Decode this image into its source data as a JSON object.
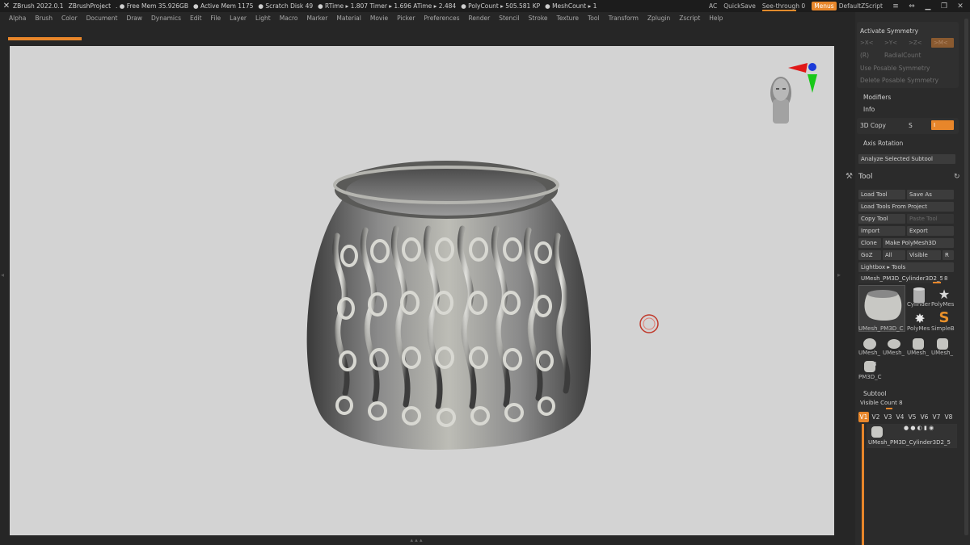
{
  "titlebar": {
    "app": "ZBrush 2022.0.1",
    "project": "ZBrushProject",
    "free_mem": ". ● Free Mem 35.926GB",
    "active_mem": "● Active Mem 1175",
    "scratch": "● Scratch Disk 49",
    "rtime": "● RTime ▸ 1.807 Timer ▸ 1.696 ATime ▸ 2.484",
    "polycount": "● PolyCount ▸ 505.581 KP",
    "meshcount": "● MeshCount ▸ 1",
    "ac": "AC",
    "quicksave": "QuickSave",
    "see_through": "See-through   0",
    "menus": "Menus",
    "zscript": "DefaultZScript"
  },
  "menu": [
    "Alpha",
    "Brush",
    "Color",
    "Document",
    "Draw",
    "Dynamics",
    "Edit",
    "File",
    "Layer",
    "Light",
    "Macro",
    "Marker",
    "Material",
    "Movie",
    "Picker",
    "Preferences",
    "Render",
    "Stencil",
    "Stroke",
    "Texture",
    "Tool",
    "Transform",
    "Zplugin",
    "Zscript",
    "Help"
  ],
  "symmetry": {
    "activate": "Activate Symmetry",
    "x": ">X<",
    "y": ">Y<",
    "z": ">Z<",
    "m": ">M<",
    "r": "(R)",
    "radial": "RadialCount",
    "use_posable": "Use Posable Symmetry",
    "delete_posable": "Delete Posable Symmetry"
  },
  "modifiers": "Modifiers",
  "info": "Info",
  "copy3d": {
    "label": "3D Copy",
    "s": "S",
    "i": "I"
  },
  "axis_rotation": "Axis Rotation",
  "analyze": "Analyze Selected Subtool",
  "tool": {
    "title": "Tool",
    "load_tool": "Load Tool",
    "save_as": "Save As",
    "load_from_project": "Load Tools From Project",
    "copy_tool": "Copy Tool",
    "paste_tool": "Paste Tool",
    "import": "Import",
    "export": "Export",
    "clone": "Clone",
    "make_polymesh": "Make PolyMesh3D",
    "goz": "GoZ",
    "all": "All",
    "visible": "Visible",
    "r": "R",
    "lightbox": "Lightbox ▸ Tools",
    "current": "UMesh_PM3D_Cylinder3D2_5",
    "current_count": "8",
    "thumbs": [
      "UMesh_PM3D_C",
      "Cylinder",
      "PolyMes",
      "PolyMes",
      "SimpleB",
      "UMesh_",
      "UMesh_",
      "UMesh_",
      "UMesh_",
      "PM3D_C"
    ],
    "thumb_count": "8"
  },
  "subtool": {
    "title": "Subtool",
    "visible_count": "Visible Count 8",
    "tabs": [
      "V1",
      "V2",
      "V3",
      "V4",
      "V5",
      "V6",
      "V7",
      "V8"
    ],
    "item": "UMesh_PM3D_Cylinder3D2_5"
  },
  "colors": {
    "accent": "#e8862a",
    "canvas": "#d3d3d3",
    "panel": "#2b2b2b"
  }
}
